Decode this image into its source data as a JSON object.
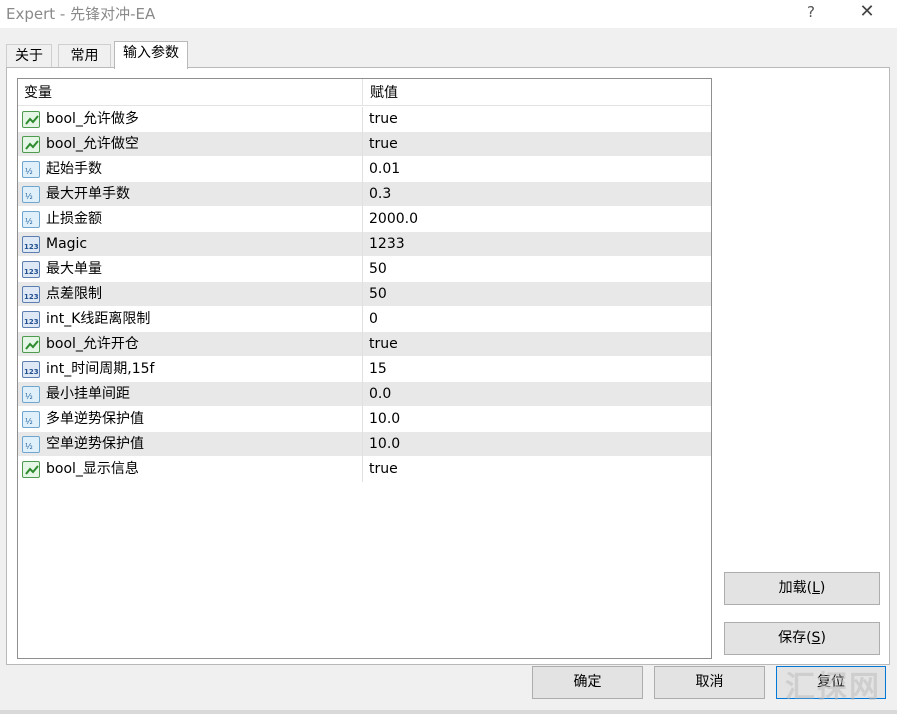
{
  "window": {
    "title": "Expert - 先锋对冲-EA",
    "help": "?",
    "close": "✕"
  },
  "tabs": [
    {
      "label": "关于"
    },
    {
      "label": "常用"
    },
    {
      "label": "输入参数"
    }
  ],
  "grid": {
    "col_name": "变量",
    "col_value": "赋值",
    "rows": [
      {
        "name": "bool_允许做多",
        "value": "true",
        "type": "bool"
      },
      {
        "name": "bool_允许做空",
        "value": "true",
        "type": "bool"
      },
      {
        "name": "起始手数",
        "value": "0.01",
        "type": "double"
      },
      {
        "name": "最大开单手数",
        "value": "0.3",
        "type": "double"
      },
      {
        "name": "止损金额",
        "value": "2000.0",
        "type": "double"
      },
      {
        "name": "Magic",
        "value": "1233",
        "type": "int"
      },
      {
        "name": "最大单量",
        "value": "50",
        "type": "int"
      },
      {
        "name": "点差限制",
        "value": "50",
        "type": "int"
      },
      {
        "name": "int_K线距离限制",
        "value": "0",
        "type": "int"
      },
      {
        "name": "bool_允许开仓",
        "value": "true",
        "type": "bool"
      },
      {
        "name": "int_时间周期,15f",
        "value": "15",
        "type": "int"
      },
      {
        "name": "最小挂单间距",
        "value": "0.0",
        "type": "double"
      },
      {
        "name": "多单逆势保护值",
        "value": "10.0",
        "type": "double"
      },
      {
        "name": "空单逆势保护值",
        "value": "10.0",
        "type": "double"
      },
      {
        "name": "bool_显示信息",
        "value": "true",
        "type": "bool"
      }
    ]
  },
  "buttons": {
    "load": {
      "text": "加载(",
      "key": "L",
      "end": ")"
    },
    "save": {
      "text": "保存(",
      "key": "S",
      "end": ")"
    },
    "ok": "确定",
    "cancel": "取消",
    "reset": "复位"
  },
  "watermark": "汇探网",
  "icons": {
    "bool": "bool-type-icon",
    "double": "double-type-icon",
    "int": "int-type-icon"
  }
}
